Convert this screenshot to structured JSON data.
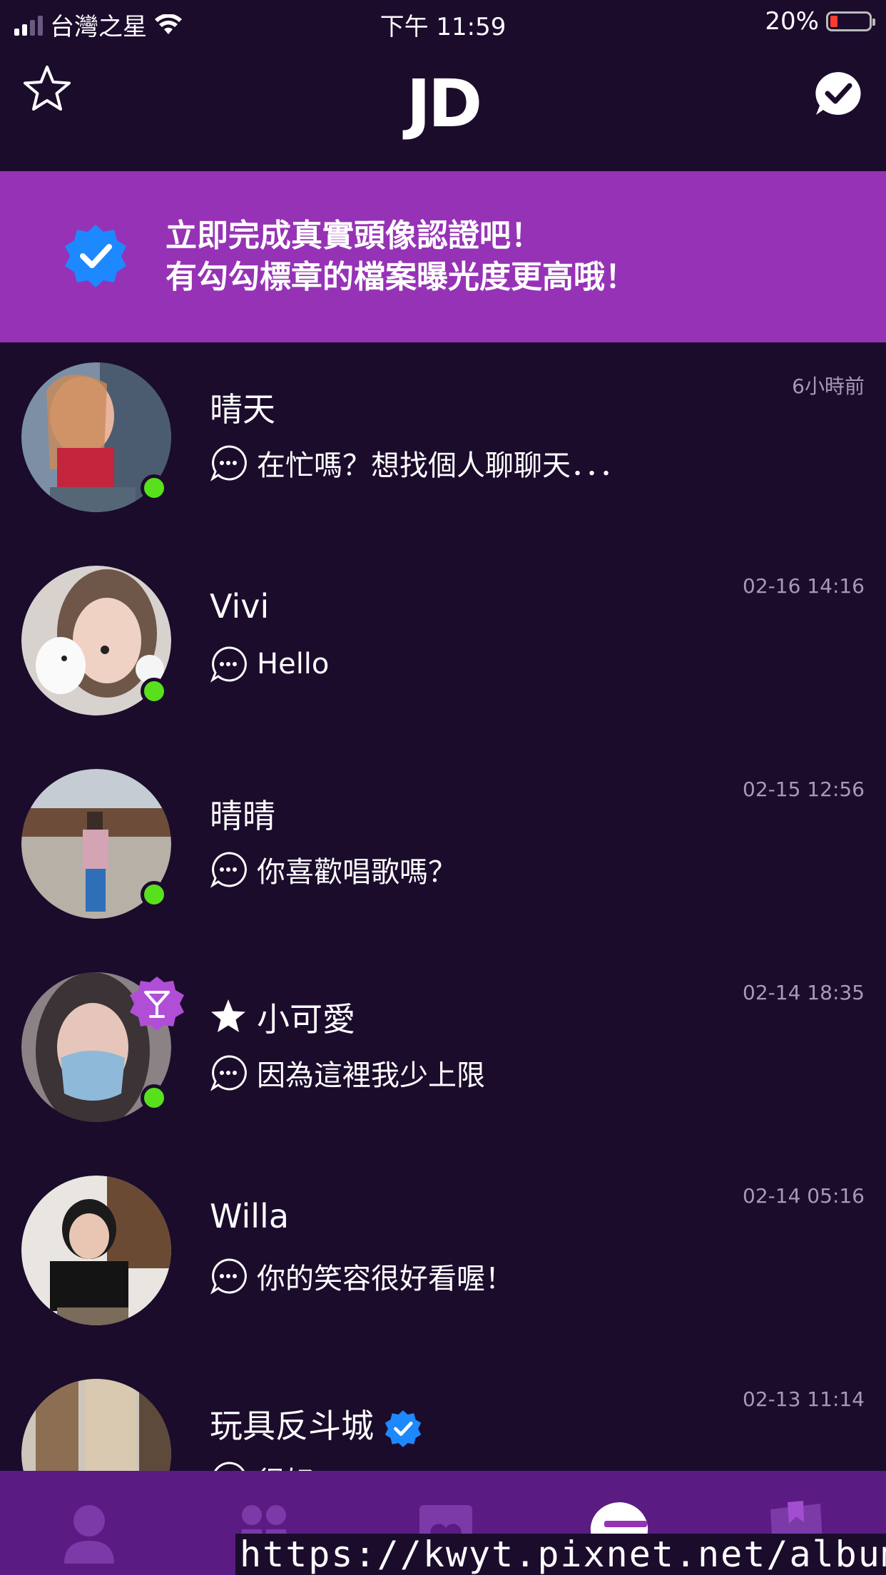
{
  "status_bar": {
    "carrier": "台灣之星",
    "time": "下午 11:59",
    "battery": "20%"
  },
  "nav": {
    "logo": "JD"
  },
  "banner": {
    "line1": "立即完成真實頭像認證吧！",
    "line2": "有勾勾標章的檔案曝光度更高哦！"
  },
  "conversations": [
    {
      "name": "晴天",
      "time": "6小時前",
      "message": "在忙嗎？想找個人聊聊天．．．"
    },
    {
      "name": "Vivi",
      "time": "02-16   14:16",
      "message": "Hello"
    },
    {
      "name": "晴晴",
      "time": "02-15   12:56",
      "message": "你喜歡唱歌嗎？"
    },
    {
      "name": "小可愛",
      "time": "02-14   18:35",
      "message": "因為這裡我少上限"
    },
    {
      "name": "Willa",
      "time": "02-14   05:16",
      "message": "你的笑容很好看喔！"
    },
    {
      "name": "玩具反斗城",
      "time": "02-13   11:14",
      "message": "很好"
    }
  ],
  "watermark": "https://kwyt.pixnet.net/album",
  "colors": {
    "background": "#1b0c2c",
    "banner": "#9632b5",
    "tabbar": "#5a1c83",
    "online": "#58e01c",
    "verified": "#1e88ff"
  }
}
